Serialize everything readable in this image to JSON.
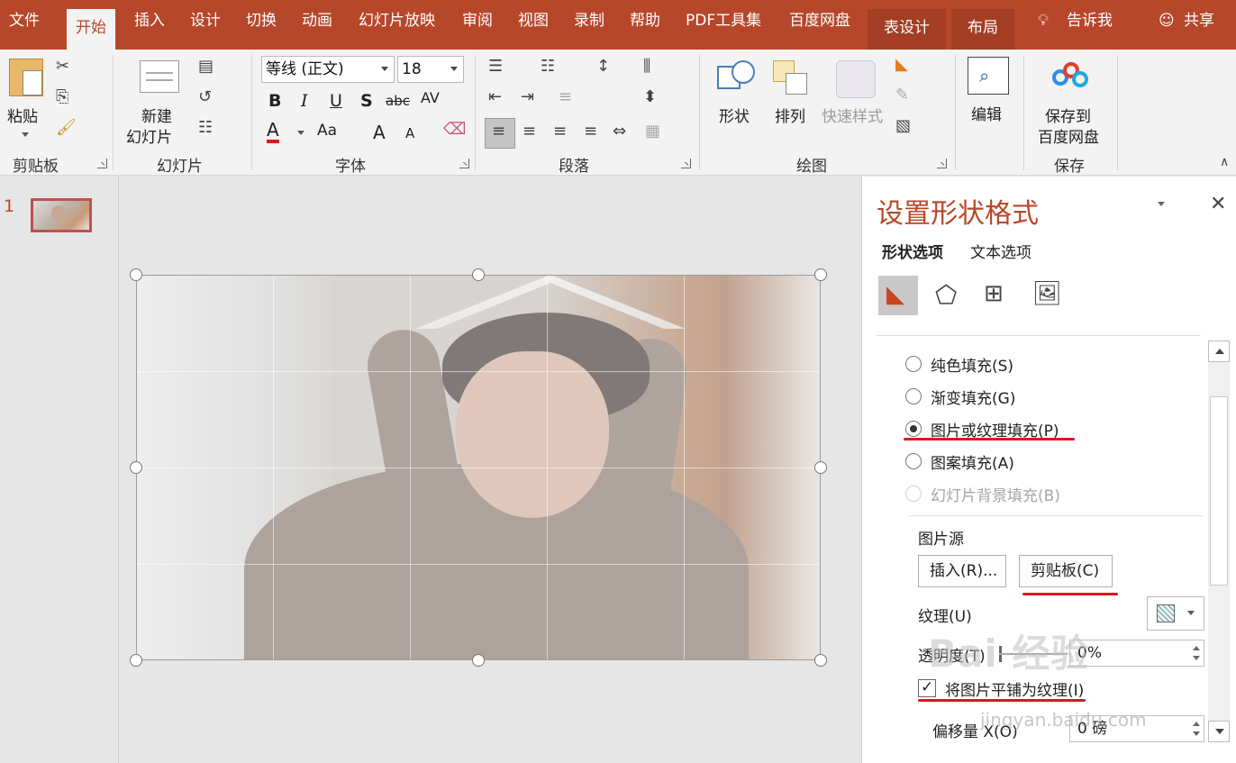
{
  "menu": {
    "tabs": [
      "文件",
      "开始",
      "插入",
      "设计",
      "切换",
      "动画",
      "幻灯片放映",
      "审阅",
      "视图",
      "录制",
      "帮助",
      "PDF工具集",
      "百度网盘",
      "表设计",
      "布局"
    ],
    "tell_me": "告诉我",
    "share": "共享"
  },
  "ribbon": {
    "clipboard": {
      "paste": "粘贴",
      "label": "剪贴板"
    },
    "slides": {
      "new_slide_line1": "新建",
      "new_slide_line2": "幻灯片",
      "label": "幻灯片"
    },
    "font": {
      "font_name": "等线 (正文)",
      "font_size": "18",
      "bold": "B",
      "italic": "I",
      "underline": "U",
      "shadow": "S",
      "strike": "abc",
      "spacing": "AV",
      "font_color": "A",
      "case": "Aa",
      "grow": "A",
      "shrink": "A",
      "label": "字体"
    },
    "paragraph": {
      "label": "段落"
    },
    "drawing": {
      "shapes": "形状",
      "arrange": "排列",
      "quick_styles": "快速样式",
      "label": "绘图"
    },
    "editing": {
      "edit": "编辑"
    },
    "save": {
      "line1": "保存到",
      "line2": "百度网盘",
      "label": "保存"
    }
  },
  "slides_pane": {
    "slide_number": "1"
  },
  "format_pane": {
    "title": "设置形状格式",
    "tabs": [
      "形状选项",
      "文本选项"
    ],
    "icons": [
      "fill-line-icon",
      "effects-icon",
      "size-properties-icon",
      "picture-icon"
    ],
    "fill_options": [
      {
        "label": "纯色填充(S)",
        "selected": false,
        "disabled": false
      },
      {
        "label": "渐变填充(G)",
        "selected": false,
        "disabled": false
      },
      {
        "label": "图片或纹理填充(P)",
        "selected": true,
        "disabled": false
      },
      {
        "label": "图案填充(A)",
        "selected": false,
        "disabled": false
      },
      {
        "label": "幻灯片背景填充(B)",
        "selected": false,
        "disabled": true
      }
    ],
    "picture_source": "图片源",
    "insert_button": "插入(R)...",
    "clipboard_button": "剪贴板(C)",
    "texture_label": "纹理(U)",
    "transparency_label": "透明度(T)",
    "transparency_value": "0%",
    "tile_checkbox_label": "将图片平铺为纹理(I)",
    "tile_checked": true,
    "offset_x_label": "偏移量 X(O)",
    "offset_x_value": "0 磅"
  },
  "watermark": {
    "text": "Bai 经验",
    "sub": "jingyan.baidu.com"
  },
  "colors": {
    "accent": "#b7472a",
    "annotation": "#e0141e"
  }
}
